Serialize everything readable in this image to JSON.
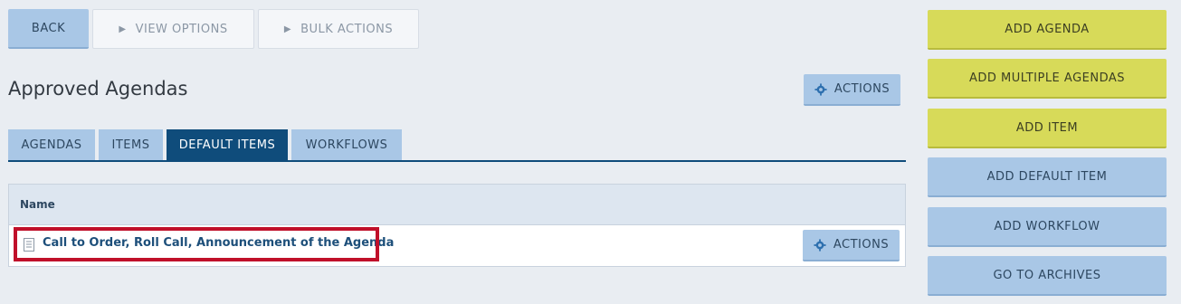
{
  "toolbar": {
    "back_label": "BACK",
    "view_options_label": "VIEW OPTIONS",
    "bulk_actions_label": "BULK ACTIONS"
  },
  "page": {
    "title": "Approved Agendas",
    "actions_label": "ACTIONS"
  },
  "tabs": [
    {
      "label": "AGENDAS",
      "active": false
    },
    {
      "label": "ITEMS",
      "active": false
    },
    {
      "label": "DEFAULT ITEMS",
      "active": true
    },
    {
      "label": "WORKFLOWS",
      "active": false
    }
  ],
  "table": {
    "header_name": "Name",
    "rows": [
      {
        "name": "Call to Order, Roll Call, Announcement of the Agenda",
        "actions_label": "ACTIONS"
      }
    ]
  },
  "sidebar": {
    "add_agenda": "ADD AGENDA",
    "add_multiple_agendas": "ADD MULTIPLE AGENDAS",
    "add_item": "ADD ITEM",
    "add_default_item": "ADD DEFAULT ITEM",
    "add_workflow": "ADD WORKFLOW",
    "go_to_archives": "GO TO ARCHIVES"
  },
  "colors": {
    "accent_blue": "#a9c7e6",
    "active_tab": "#0f4c7b",
    "yellow": "#d7da59",
    "highlight": "#c0102a"
  }
}
